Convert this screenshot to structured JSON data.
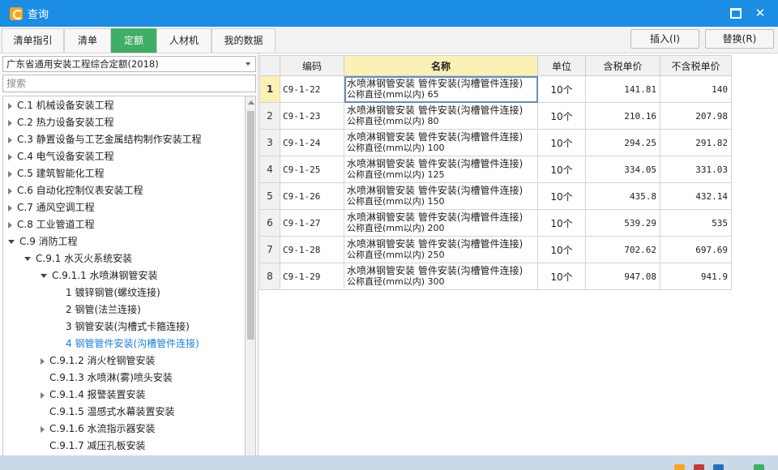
{
  "window": {
    "title": "查询"
  },
  "tabs": [
    {
      "label": "清单指引",
      "active": false
    },
    {
      "label": "清单",
      "active": false
    },
    {
      "label": "定额",
      "active": true
    },
    {
      "label": "人材机",
      "active": false
    },
    {
      "label": "我的数据",
      "active": false
    }
  ],
  "toolbar": {
    "insert_label": "插入(I)",
    "replace_label": "替换(R)"
  },
  "left": {
    "quota_select": "广东省通用安装工程综合定额(2018)",
    "search_placeholder": "搜索",
    "tree": [
      {
        "label": "C.1 机械设备安装工程",
        "level": 0,
        "expander": "collapsed"
      },
      {
        "label": "C.2 热力设备安装工程",
        "level": 0,
        "expander": "collapsed"
      },
      {
        "label": "C.3 静置设备与工艺金属结构制作安装工程",
        "level": 0,
        "expander": "collapsed"
      },
      {
        "label": "C.4 电气设备安装工程",
        "level": 0,
        "expander": "collapsed"
      },
      {
        "label": "C.5 建筑智能化工程",
        "level": 0,
        "expander": "collapsed"
      },
      {
        "label": "C.6 自动化控制仪表安装工程",
        "level": 0,
        "expander": "collapsed"
      },
      {
        "label": "C.7 通风空调工程",
        "level": 0,
        "expander": "collapsed"
      },
      {
        "label": "C.8 工业管道工程",
        "level": 0,
        "expander": "collapsed"
      },
      {
        "label": "C.9 消防工程",
        "level": 0,
        "expander": "expanded"
      },
      {
        "label": "C.9.1 水灭火系统安装",
        "level": 1,
        "expander": "expanded"
      },
      {
        "label": "C.9.1.1 水喷淋钢管安装",
        "level": 2,
        "expander": "expanded"
      },
      {
        "label": "1 镀锌钢管(螺纹连接)",
        "level": 3,
        "expander": "none"
      },
      {
        "label": "2 钢管(法兰连接)",
        "level": 3,
        "expander": "none"
      },
      {
        "label": "3 钢管安装(沟槽式卡箍连接)",
        "level": 3,
        "expander": "none"
      },
      {
        "label": "4 钢管管件安装(沟槽管件连接)",
        "level": 3,
        "expander": "none",
        "selected": true
      },
      {
        "label": "C.9.1.2 消火栓钢管安装",
        "level": 2,
        "expander": "collapsed"
      },
      {
        "label": "C.9.1.3 水喷淋(雾)喷头安装",
        "level": 2,
        "expander": "none"
      },
      {
        "label": "C.9.1.4 报警装置安装",
        "level": 2,
        "expander": "collapsed"
      },
      {
        "label": "C.9.1.5 温感式水幕装置安装",
        "level": 2,
        "expander": "none"
      },
      {
        "label": "C.9.1.6 水流指示器安装",
        "level": 2,
        "expander": "collapsed"
      },
      {
        "label": "C.9.1.7 减压孔板安装",
        "level": 2,
        "expander": "none"
      }
    ]
  },
  "grid": {
    "columns": [
      "编码",
      "名称",
      "单位",
      "含税单价",
      "不含税单价"
    ],
    "rows": [
      {
        "no": "1",
        "code": "C9-1-22",
        "name": "水喷淋钢管安装 管件安装(沟槽管件连接)",
        "spec": "公称直径(mm以内) 65",
        "unit": "10个",
        "tax_price": "141.81",
        "notax_price": "140"
      },
      {
        "no": "2",
        "code": "C9-1-23",
        "name": "水喷淋钢管安装 管件安装(沟槽管件连接)",
        "spec": "公称直径(mm以内) 80",
        "unit": "10个",
        "tax_price": "210.16",
        "notax_price": "207.98"
      },
      {
        "no": "3",
        "code": "C9-1-24",
        "name": "水喷淋钢管安装 管件安装(沟槽管件连接)",
        "spec": "公称直径(mm以内) 100",
        "unit": "10个",
        "tax_price": "294.25",
        "notax_price": "291.82"
      },
      {
        "no": "4",
        "code": "C9-1-25",
        "name": "水喷淋钢管安装 管件安装(沟槽管件连接)",
        "spec": "公称直径(mm以内) 125",
        "unit": "10个",
        "tax_price": "334.05",
        "notax_price": "331.03"
      },
      {
        "no": "5",
        "code": "C9-1-26",
        "name": "水喷淋钢管安装 管件安装(沟槽管件连接)",
        "spec": "公称直径(mm以内) 150",
        "unit": "10个",
        "tax_price": "435.8",
        "notax_price": "432.14"
      },
      {
        "no": "6",
        "code": "C9-1-27",
        "name": "水喷淋钢管安装 管件安装(沟槽管件连接)",
        "spec": "公称直径(mm以内) 200",
        "unit": "10个",
        "tax_price": "539.29",
        "notax_price": "535"
      },
      {
        "no": "7",
        "code": "C9-1-28",
        "name": "水喷淋钢管安装 管件安装(沟槽管件连接)",
        "spec": "公称直径(mm以内) 250",
        "unit": "10个",
        "tax_price": "702.62",
        "notax_price": "697.69"
      },
      {
        "no": "8",
        "code": "C9-1-29",
        "name": "水喷淋钢管安装 管件安装(沟槽管件连接)",
        "spec": "公称直径(mm以内) 300",
        "unit": "10个",
        "tax_price": "947.08",
        "notax_price": "941.9"
      }
    ]
  },
  "colors": {
    "titlebar": "#1b8de3",
    "active_tab": "#3fae66",
    "selected_text": "#1a7fd4",
    "header_highlight": "#fbf0b6"
  }
}
